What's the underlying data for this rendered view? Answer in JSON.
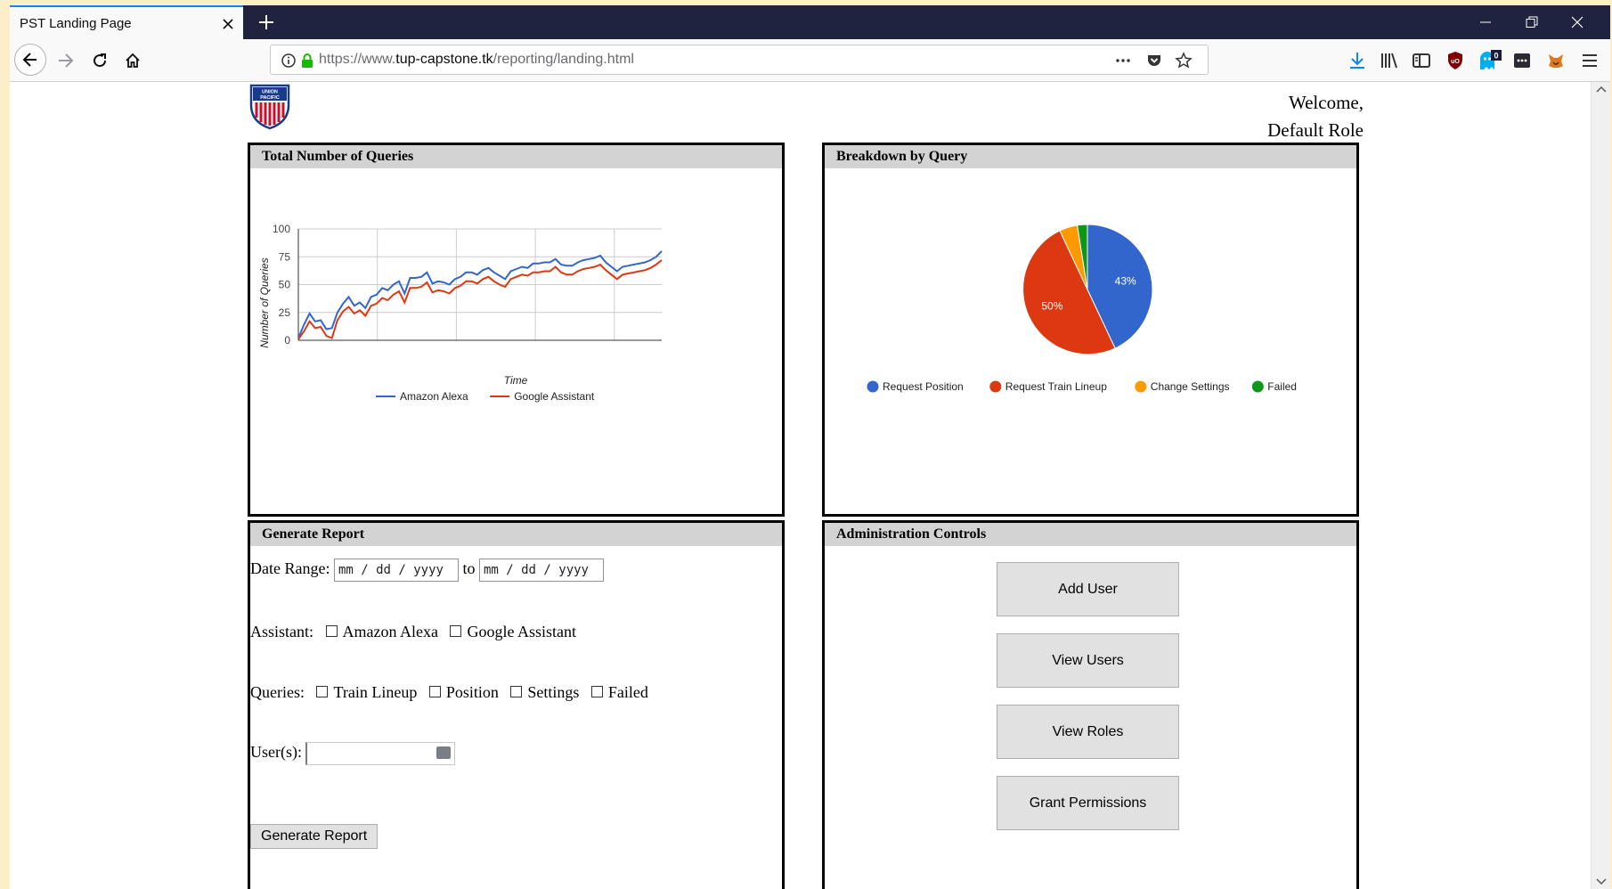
{
  "browser": {
    "tab_title": "PST Landing Page",
    "url_scheme": "https://www.",
    "url_host": "tup-capstone.tk",
    "url_path": "/reporting/landing.html",
    "badge_count": "0"
  },
  "header": {
    "welcome_line1": "Welcome,",
    "welcome_line2": "Default Role"
  },
  "panels": {
    "queries_title": "Total Number of Queries",
    "breakdown_title": "Breakdown by Query",
    "report_title": "Generate Report",
    "admin_title": "Administration Controls"
  },
  "report": {
    "date_range_label": "Date Range:",
    "date_placeholder": "mm / dd / yyyy",
    "to_label": "to",
    "assistant_label": "Assistant:",
    "assistant_options": [
      "Amazon Alexa",
      "Google Assistant"
    ],
    "queries_label": "Queries:",
    "query_options": [
      "Train Lineup",
      "Position",
      "Settings",
      "Failed"
    ],
    "users_label": "User(s):",
    "generate_button": "Generate Report"
  },
  "admin": {
    "buttons": [
      "Add User",
      "View Users",
      "View Roles",
      "Grant Permissions"
    ]
  },
  "chart_data": [
    {
      "type": "line",
      "title": "",
      "xlabel": "Time",
      "ylabel": "Number of Queries",
      "ylim": [
        0,
        100
      ],
      "yticks": [
        0,
        25,
        50,
        75,
        100
      ],
      "grid": true,
      "legend_position": "bottom",
      "series": [
        {
          "name": "Amazon Alexa",
          "color": "#3366cc",
          "values": [
            2,
            14,
            24,
            17,
            18,
            10,
            11,
            25,
            33,
            39,
            31,
            34,
            29,
            39,
            41,
            47,
            45,
            50,
            53,
            42,
            56,
            56,
            57,
            61,
            51,
            53,
            52,
            50,
            55,
            57,
            61,
            61,
            59,
            63,
            65,
            61,
            58,
            55,
            62,
            64,
            66,
            65,
            69,
            69,
            70,
            70,
            73,
            68,
            67,
            67,
            70,
            72,
            73,
            74,
            76,
            70,
            66,
            62,
            66,
            67,
            68,
            69,
            70,
            72,
            75,
            80
          ]
        },
        {
          "name": "Google Assistant",
          "color": "#dc3912",
          "values": [
            1,
            8,
            17,
            11,
            12,
            4,
            2,
            18,
            26,
            30,
            24,
            27,
            22,
            31,
            33,
            38,
            36,
            41,
            44,
            34,
            47,
            47,
            48,
            52,
            43,
            45,
            44,
            42,
            47,
            49,
            53,
            53,
            51,
            55,
            57,
            53,
            50,
            48,
            55,
            57,
            59,
            58,
            61,
            61,
            62,
            62,
            66,
            61,
            59,
            59,
            62,
            64,
            65,
            66,
            68,
            63,
            59,
            55,
            59,
            60,
            61,
            62,
            63,
            65,
            68,
            72
          ]
        }
      ]
    },
    {
      "type": "pie",
      "title": "",
      "legend_position": "bottom",
      "categories": [
        "Request Position",
        "Request Train Lineup",
        "Change Settings",
        "Failed"
      ],
      "values": [
        43,
        50,
        4.5,
        2.5
      ],
      "colors": [
        "#3366cc",
        "#dc3912",
        "#ff9900",
        "#109618"
      ],
      "data_labels": [
        "43%",
        "50%",
        "",
        ""
      ]
    }
  ]
}
